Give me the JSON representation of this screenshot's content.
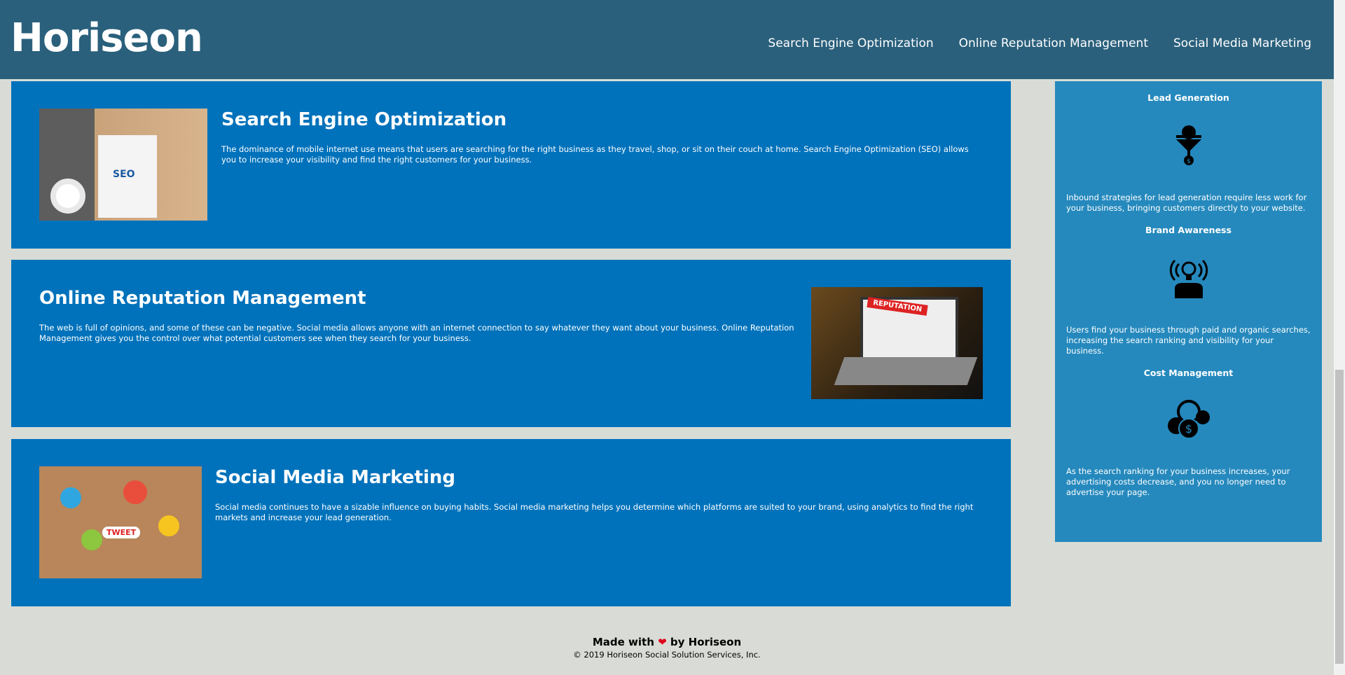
{
  "header": {
    "logo": "Horiseon",
    "nav": [
      "Search Engine Optimization",
      "Online Reputation Management",
      "Social Media Marketing"
    ]
  },
  "cards": [
    {
      "title": "Search Engine Optimization",
      "text": "The dominance of mobile internet use means that users are searching for the right business as they travel, shop, or sit on their couch at home. Search Engine Optimization (SEO) allows you to increase your visibility and find the right customers for your business.",
      "image_label": "SEO"
    },
    {
      "title": "Online Reputation Management",
      "text": "The web is full of opinions, and some of these can be negative. Social media allows anyone with an internet connection to say whatever they want about your business. Online Reputation Management gives you the control over what potential customers see when they search for your business.",
      "image_label": "REPUTATION"
    },
    {
      "title": "Social Media Marketing",
      "text": "Social media continues to have a sizable influence on buying habits. Social media marketing helps you determine which platforms are suited to your brand, using analytics to find the right markets and increase your lead generation.",
      "image_label": "TWEET"
    }
  ],
  "benefits": [
    {
      "title": "Lead Generation",
      "text": "Inbound strategies for lead generation require less work for your business, bringing customers directly to your website.",
      "icon": "funnel-gear-icon"
    },
    {
      "title": "Brand Awareness",
      "text": "Users find your business through paid and organic searches, increasing the search ranking and visibility for your business.",
      "icon": "lightbulb-person-icon"
    },
    {
      "title": "Cost Management",
      "text": "As the search ranking for your business increases, your advertising costs decrease, and you no longer need to advertise your page.",
      "icon": "coins-gear-icon"
    }
  ],
  "footer": {
    "made_prefix": "Made with",
    "heart": "❤",
    "made_suffix": "by Horiseon",
    "copyright": "© 2019 Horiseon Social Solution Services, Inc."
  },
  "colors": {
    "header": "#2a607c",
    "card": "#0072bb",
    "aside": "#2589bd",
    "background": "#d9dcd6"
  }
}
